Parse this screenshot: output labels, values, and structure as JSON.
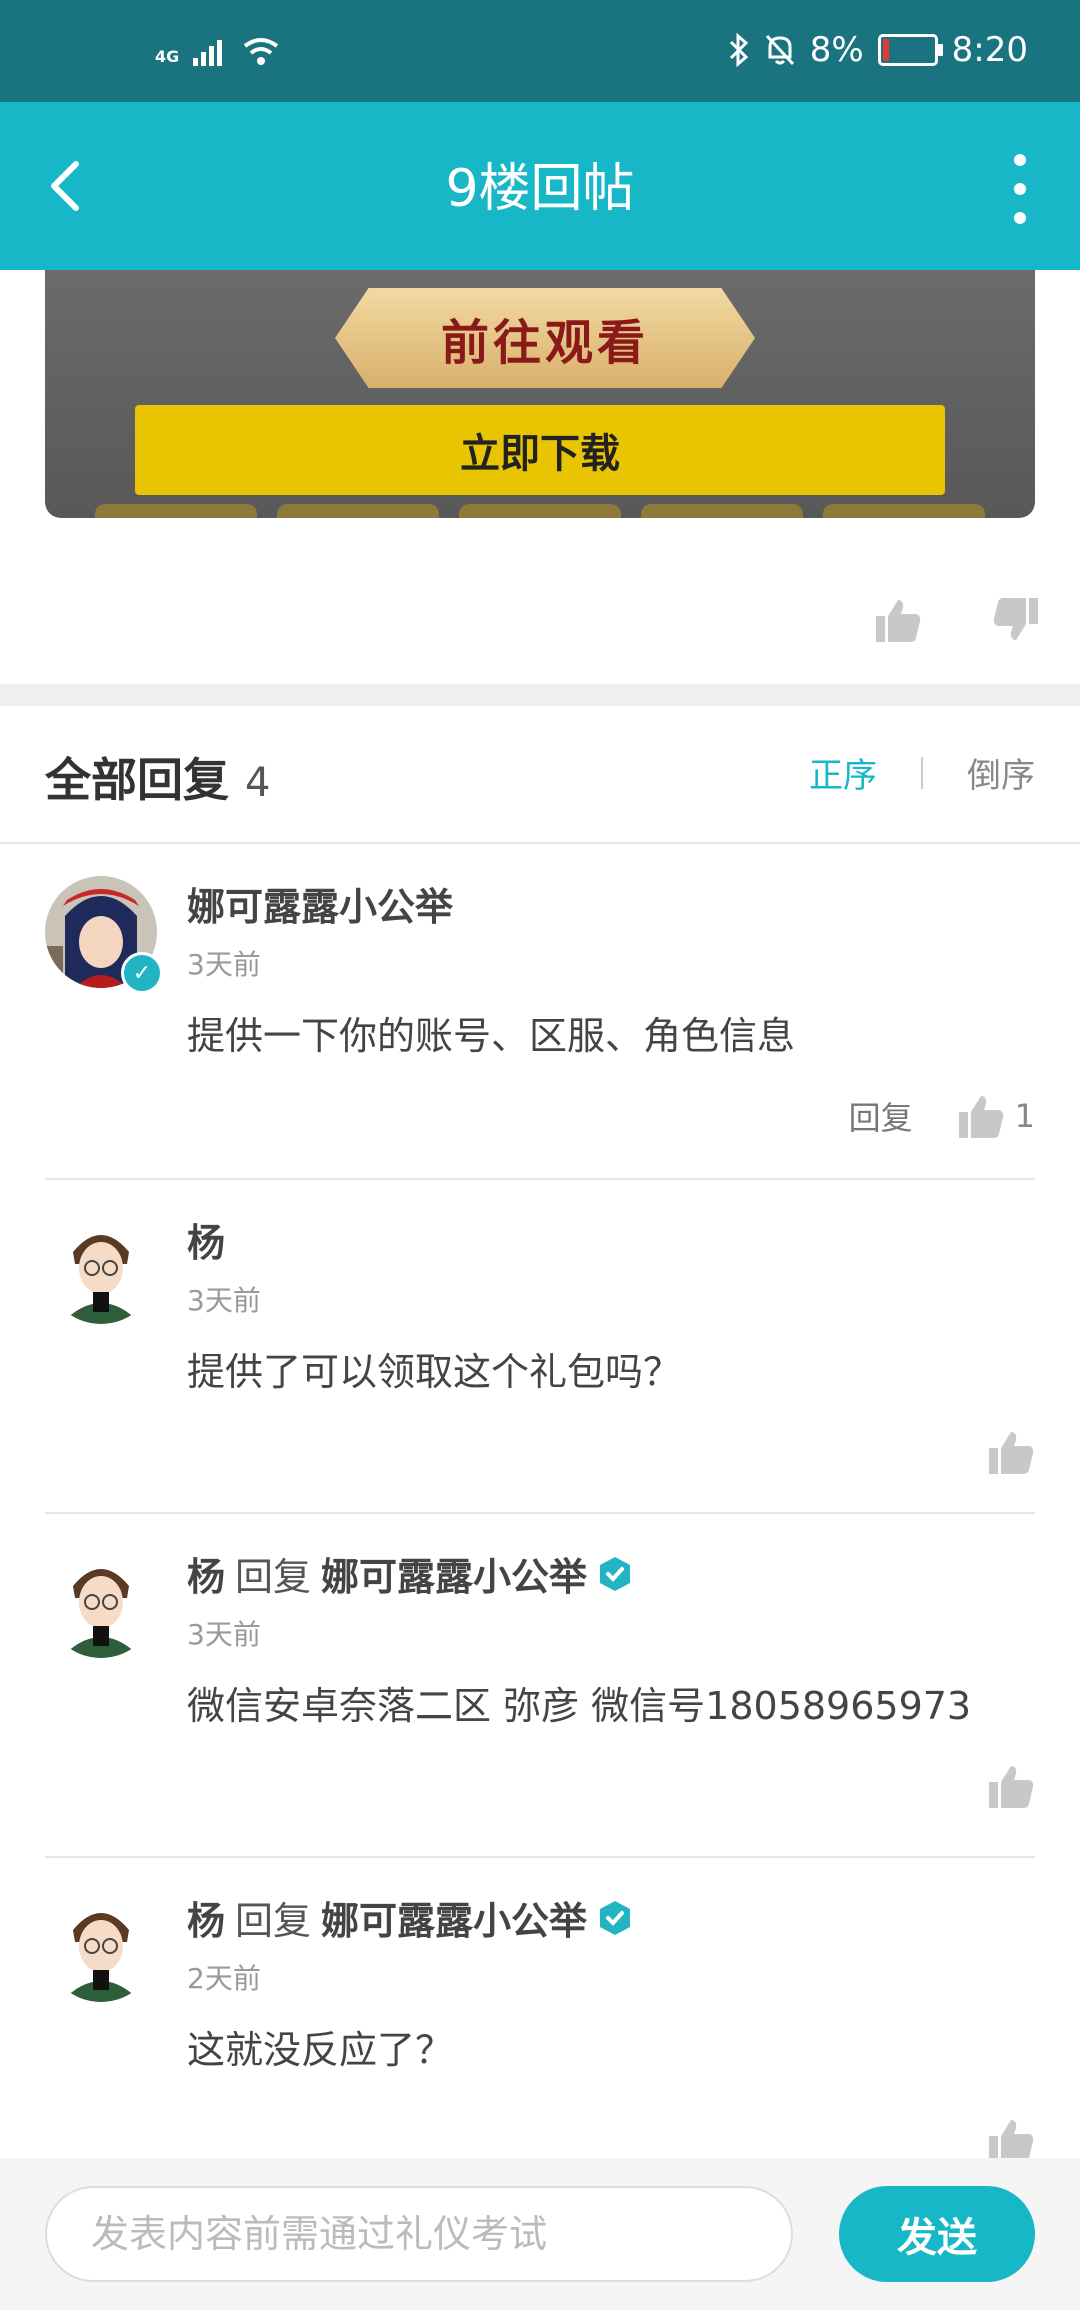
{
  "status_bar": {
    "network": "4G",
    "battery_pct": "8%",
    "time": "8:20"
  },
  "header": {
    "title": "9楼回帖"
  },
  "banner": {
    "plaque_text": "前往观看",
    "download_text": "立即下载"
  },
  "replies": {
    "title": "全部回复",
    "count": "4",
    "sort_asc": "正序",
    "sort_desc": "倒序"
  },
  "comments": [
    {
      "name": "娜可露露小公举",
      "time": "3天前",
      "text": "提供一下你的账号、区服、角色信息",
      "reply_label": "回复",
      "likes": "1"
    },
    {
      "name": "杨",
      "time": "3天前",
      "text": "提供了可以领取这个礼包吗？"
    },
    {
      "name": "杨",
      "reply_word": "回复",
      "reply_to": "娜可露露小公举",
      "time": "3天前",
      "text": "微信安卓奈落二区  弥彦 微信号18058965973"
    },
    {
      "name": "杨",
      "reply_word": "回复",
      "reply_to": "娜可露露小公举",
      "time": "2天前",
      "text": "这就没反应了？"
    }
  ],
  "composer": {
    "placeholder": "发表内容前需通过礼仪考试",
    "send_label": "发送"
  },
  "colors": {
    "status_bar": "#1a7480",
    "accent": "#17b7c7"
  }
}
